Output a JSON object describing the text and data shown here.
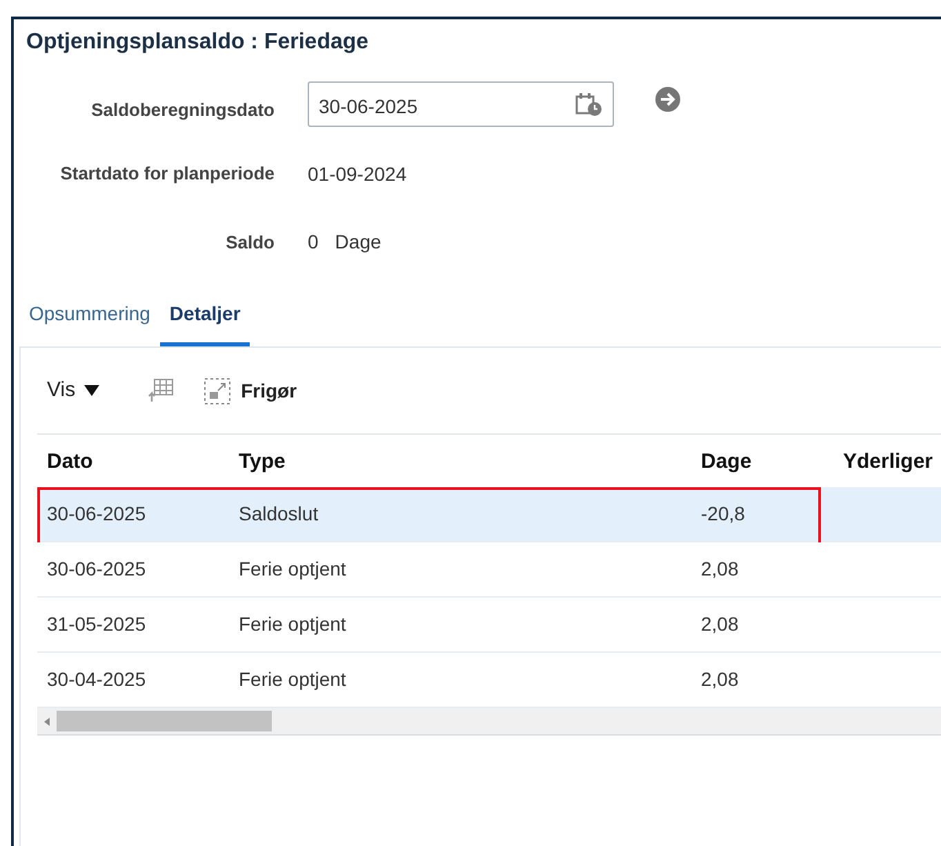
{
  "title": "Optjeningsplansaldo : Feriedage",
  "form": [
    {
      "kind": "date_field",
      "label": "Saldoberegningsdato",
      "value": "30-06-2025"
    },
    {
      "kind": "text",
      "label": "Startdato for planperiode",
      "value": "01-09-2024"
    },
    {
      "kind": "amount",
      "label": "Saldo",
      "value": "0",
      "unit": "Dage"
    }
  ],
  "tabs": [
    {
      "label": "Opsummering",
      "selected": false
    },
    {
      "label": "Detaljer",
      "selected": true
    }
  ],
  "toolbar": {
    "view_menu": "Vis",
    "detach": "Frigør"
  },
  "table": {
    "columns": [
      "Dato",
      "Type",
      "Dage",
      "Yderliger"
    ],
    "rows": [
      {
        "cells": [
          "30-06-2025",
          "Saldoslut",
          "-20,8"
        ],
        "selected": true,
        "outlined": true
      },
      {
        "cells": [
          "30-06-2025",
          "Ferie optjent",
          "2,08"
        ],
        "selected": false,
        "outlined": false
      },
      {
        "cells": [
          "31-05-2025",
          "Ferie optjent",
          "2,08"
        ],
        "selected": false,
        "outlined": false
      },
      {
        "cells": [
          "30-04-2025",
          "Ferie optjent",
          "2,08"
        ],
        "selected": false,
        "outlined": false
      }
    ]
  }
}
